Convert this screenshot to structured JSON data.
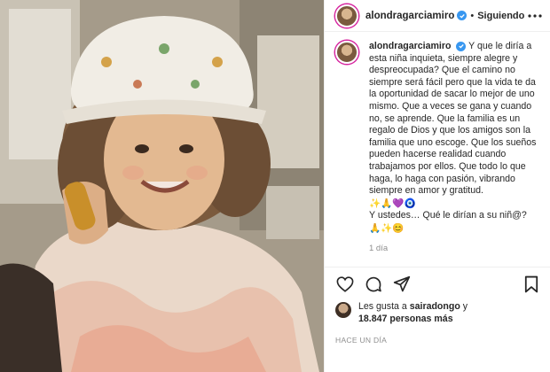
{
  "post": {
    "photo_alt": "",
    "header": {
      "username": "alondragarciamiro",
      "separator": "•",
      "follow_status": "Siguiendo"
    },
    "caption": {
      "username": "alondragarciamiro",
      "text": "Y que le diría a esta niña inquieta, siempre alegre y despreocupada? Que el camino no siempre será fácil pero que la vida te da la oportunidad de sacar lo mejor de uno mismo. Que a veces se gana y cuando no, se aprende. Que la familia es un regalo de Dios y que los amigos son la familia que uno escoge. Que los sueños pueden hacerse realidad cuando trabajamos por ellos. Que todo lo que haga, lo haga con pasión, vibrando siempre en amor y gratitud.",
      "emoji_line_1": "✨🙏💜🧿",
      "question": "Y ustedes… Qué le dirían a su niñ@?",
      "emoji_line_2": "🙏✨😊",
      "time": "1 día"
    },
    "likes": {
      "prefix": "Les gusta a ",
      "user": "sairadongo",
      "middle": " y",
      "count": "18.847 personas más"
    },
    "posted_ago": "HACE UN DÍA",
    "icons": {
      "more": "more-options-icon",
      "like": "heart-icon",
      "comment": "comment-icon",
      "share": "share-icon",
      "save": "bookmark-icon",
      "verified": "verified-badge-icon"
    },
    "colors": {
      "verified": "#3897f0",
      "muted": "#8e8e8e",
      "text": "#262626"
    }
  }
}
